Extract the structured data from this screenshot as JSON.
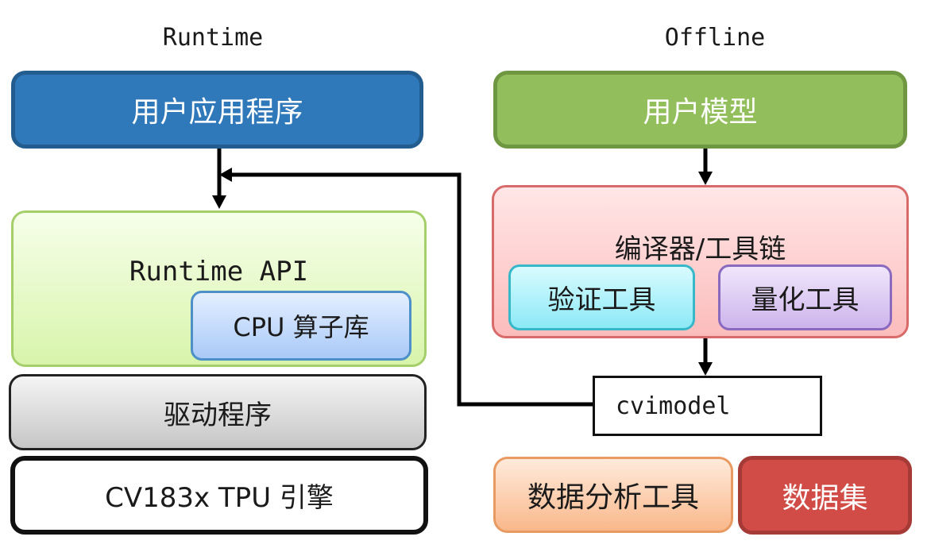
{
  "headings": {
    "runtime": "Runtime",
    "offline": "Offline"
  },
  "boxes": {
    "user_app": "用户应用程序",
    "user_model": "用户模型",
    "runtime_api": "Runtime API",
    "cpu_lib": "CPU 算子库",
    "driver": "驱动程序",
    "tpu_engine": "CV183x TPU 引擎",
    "compiler": "编译器/工具链",
    "verify_tool": "验证工具",
    "quant_tool": "量化工具",
    "cvimodel": "cvimodel",
    "data_tool": "数据分析工具",
    "dataset": "数据集"
  },
  "colors": {
    "user_app": "#2f78b9",
    "user_model": "#92bf5b",
    "dataset": "#d24c47",
    "arrow": "#000000"
  }
}
